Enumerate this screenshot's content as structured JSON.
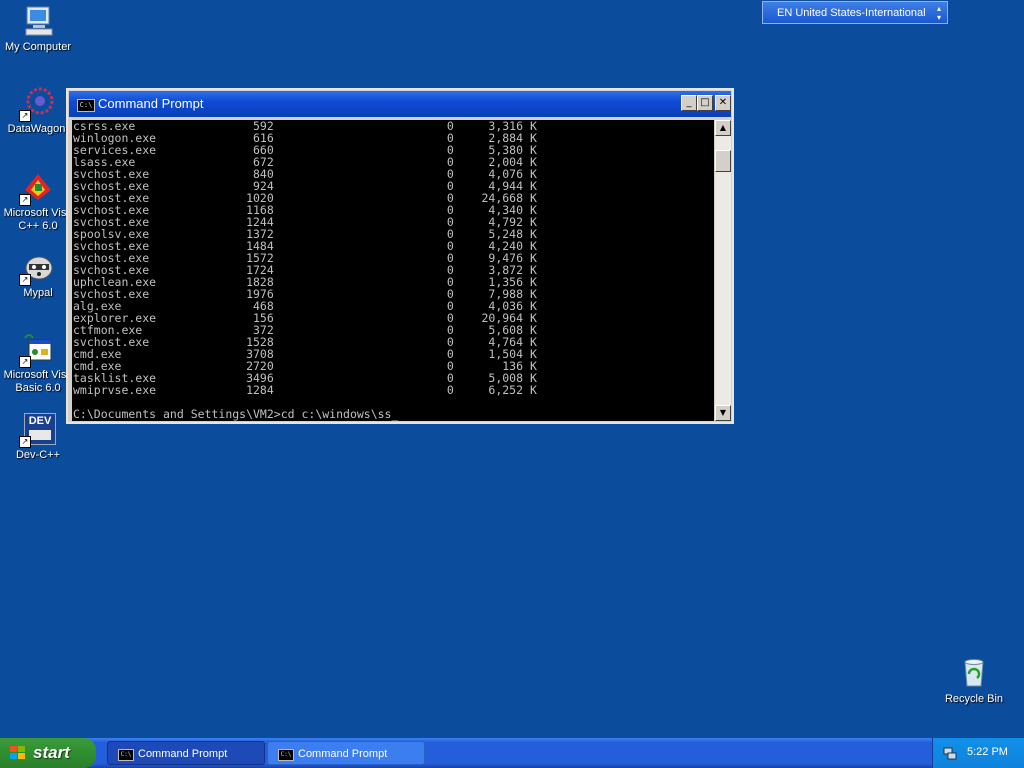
{
  "desktop": {
    "icons": [
      {
        "label": "My Computer",
        "name": "my-computer-icon"
      },
      {
        "label": "DataWagon.",
        "name": "datawagon-icon"
      },
      {
        "label_line1": "Microsoft Visu",
        "label_line2": "C++ 6.0",
        "name": "msvc-icon"
      },
      {
        "label": "Mypal",
        "name": "mypal-icon"
      },
      {
        "label_line1": "Microsoft Visu",
        "label_line2": "Basic 6.0",
        "name": "vb6-icon"
      },
      {
        "label": "Dev-C++",
        "name": "devcpp-icon"
      },
      {
        "label": "Recycle Bin",
        "name": "recycle-bin-icon"
      }
    ],
    "dev_badge": "DEV"
  },
  "language_bar": {
    "label": "EN United States-International"
  },
  "window": {
    "title": "Command Prompt",
    "icon_text": "C:\\",
    "buttons": {
      "minimize": "_",
      "maximize": "□",
      "close": "✕"
    },
    "processes": [
      {
        "name": "csrss.exe",
        "pid": "592",
        "session": "0",
        "mem": "3,316 K"
      },
      {
        "name": "winlogon.exe",
        "pid": "616",
        "session": "0",
        "mem": "2,884 K"
      },
      {
        "name": "services.exe",
        "pid": "660",
        "session": "0",
        "mem": "5,380 K"
      },
      {
        "name": "lsass.exe",
        "pid": "672",
        "session": "0",
        "mem": "2,004 K"
      },
      {
        "name": "svchost.exe",
        "pid": "840",
        "session": "0",
        "mem": "4,076 K"
      },
      {
        "name": "svchost.exe",
        "pid": "924",
        "session": "0",
        "mem": "4,944 K"
      },
      {
        "name": "svchost.exe",
        "pid": "1020",
        "session": "0",
        "mem": "24,668 K"
      },
      {
        "name": "svchost.exe",
        "pid": "1168",
        "session": "0",
        "mem": "4,340 K"
      },
      {
        "name": "svchost.exe",
        "pid": "1244",
        "session": "0",
        "mem": "4,792 K"
      },
      {
        "name": "spoolsv.exe",
        "pid": "1372",
        "session": "0",
        "mem": "5,248 K"
      },
      {
        "name": "svchost.exe",
        "pid": "1484",
        "session": "0",
        "mem": "4,240 K"
      },
      {
        "name": "svchost.exe",
        "pid": "1572",
        "session": "0",
        "mem": "9,476 K"
      },
      {
        "name": "svchost.exe",
        "pid": "1724",
        "session": "0",
        "mem": "3,872 K"
      },
      {
        "name": "uphclean.exe",
        "pid": "1828",
        "session": "0",
        "mem": "1,356 K"
      },
      {
        "name": "svchost.exe",
        "pid": "1976",
        "session": "0",
        "mem": "7,988 K"
      },
      {
        "name": "alg.exe",
        "pid": "468",
        "session": "0",
        "mem": "4,036 K"
      },
      {
        "name": "explorer.exe",
        "pid": "156",
        "session": "0",
        "mem": "20,964 K"
      },
      {
        "name": "ctfmon.exe",
        "pid": "372",
        "session": "0",
        "mem": "5,608 K"
      },
      {
        "name": "svchost.exe",
        "pid": "1528",
        "session": "0",
        "mem": "4,764 K"
      },
      {
        "name": "cmd.exe",
        "pid": "3708",
        "session": "0",
        "mem": "1,504 K"
      },
      {
        "name": "cmd.exe",
        "pid": "2720",
        "session": "0",
        "mem": "136 K"
      },
      {
        "name": "tasklist.exe",
        "pid": "3496",
        "session": "0",
        "mem": "5,008 K"
      },
      {
        "name": "wmiprvse.exe",
        "pid": "1284",
        "session": "0",
        "mem": "6,252 K"
      }
    ],
    "prompt": "C:\\Documents and Settings\\VM2>cd c:\\windows\\ss_"
  },
  "taskbar": {
    "start_label": "start",
    "items": [
      {
        "label": "Command Prompt"
      },
      {
        "label": "Command Prompt"
      }
    ],
    "clock": "5:22 PM"
  },
  "colors": {
    "desktop": "#0b4c9c",
    "console_bg": "#000000",
    "console_fg": "#c0c0c0",
    "titlebar": "#0f4cd4"
  }
}
